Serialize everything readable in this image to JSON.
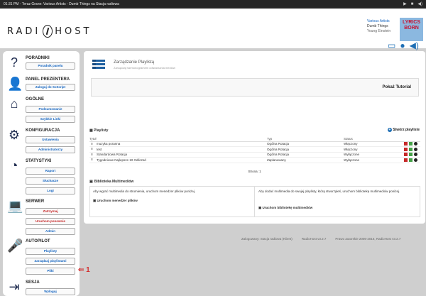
{
  "topbar": {
    "now_playing": "01:31 PM - Teraz Grane: Various Artists - Dumb Things na Stacja radiowa",
    "player_icons": [
      "play-icon",
      "stop-icon",
      "volume-icon"
    ]
  },
  "header": {
    "logo_left": "RADI",
    "logo_right": "HOST",
    "track": {
      "artist": "Various Artists",
      "title": "Dumb Things",
      "subtitle": "Young Einstein"
    },
    "cover_text": "LYRICS BORN",
    "icons": [
      "monitor-icon",
      "microphone-icon",
      "volume-icon"
    ]
  },
  "sidebar": {
    "sections": [
      {
        "icon": "question-icon",
        "title": "PORADNIKI",
        "buttons": [
          {
            "label": "Poradnik panelu",
            "color": "blue"
          }
        ]
      },
      {
        "icon": "user-icon",
        "title": "PANEL PREZENTERA",
        "buttons": [
          {
            "label": "Zaloguj do ScScript",
            "color": "blue"
          }
        ]
      },
      {
        "icon": "home-icon",
        "title": "OGÓLNE",
        "buttons": [
          {
            "label": "Podsumowanie",
            "color": "blue"
          },
          {
            "label": "Szybkie Linki",
            "color": "blue"
          }
        ]
      },
      {
        "icon": "gear-icon",
        "title": "KONFIGURACJA",
        "buttons": [
          {
            "label": "Ustawienia",
            "color": "blue"
          },
          {
            "label": "Administratorzy",
            "color": "blue"
          }
        ]
      },
      {
        "icon": "pie-chart-icon",
        "title": "STATYSTYKI",
        "buttons": [
          {
            "label": "Raport",
            "color": "blue"
          },
          {
            "label": "Słuchacze",
            "color": "blue"
          },
          {
            "label": "Logi",
            "color": "blue"
          }
        ]
      },
      {
        "icon": "laptop-icon",
        "title": "SERWER",
        "buttons": [
          {
            "label": "Zatrzymaj",
            "color": "red"
          },
          {
            "label": "Uruchom ponownie",
            "color": "red"
          },
          {
            "label": "Admin",
            "color": "blue"
          }
        ]
      },
      {
        "icon": "microphone-icon",
        "title": "AUTOPILOT",
        "buttons": [
          {
            "label": "Playlisty",
            "color": "blue"
          },
          {
            "label": "Zarządzaj playlistami",
            "color": "blue"
          },
          {
            "label": "Pliki",
            "color": "blue"
          }
        ]
      },
      {
        "icon": "logout-icon",
        "title": "SESJA",
        "buttons": [
          {
            "label": "Wyloguj",
            "color": "blue"
          }
        ]
      }
    ],
    "annotation": "1"
  },
  "main": {
    "title": "Zarządzanie Playlistą",
    "subtitle": "Zarządzaj harmonogramem odtwarzania mediów",
    "tutorial_label": "Pokaż Tutorial",
    "playlists_header": "Playlisty",
    "add_playlist": "Stwórz playliste",
    "columns": [
      "Tytuł",
      "Typ",
      "Status"
    ],
    "rows": [
      {
        "title": "muzyka poranna",
        "type": "Ogólna Rotacja",
        "status": "Włączony"
      },
      {
        "title": "test",
        "type": "Ogólna Rotacja",
        "status": "Włączony"
      },
      {
        "title": "Standardowa Rotacja",
        "type": "Ogólna Rotacja",
        "status": "Wyłączone"
      },
      {
        "title": "Tygodniowe Najlepsze 10 Odliczań",
        "type": "Zaplanowany",
        "status": "Wyłączone"
      }
    ],
    "pager": "Strona: 1",
    "library_header": "Biblioteka Multimediów",
    "library_left_text": "Aby wgrać multimedia do strumienia, uruchom menedżer plików poniżej.",
    "library_left_link": "Uruchom menedżer plików",
    "library_right_text": "Aby dodać multimedia do swojej playlisty, którą stworzyłeś, uruchom bibliotekę multimediów poniżej.",
    "library_right_link": "Uruchom bibliotekę multimediów"
  },
  "footer": {
    "logged": "Zalogowany:",
    "station": "Stacja radiowa (Klient)",
    "version": "RadioHost v3.2.7",
    "copyright": "Prawo autorskie 2006-2016, RadioHost v3.2.7"
  }
}
